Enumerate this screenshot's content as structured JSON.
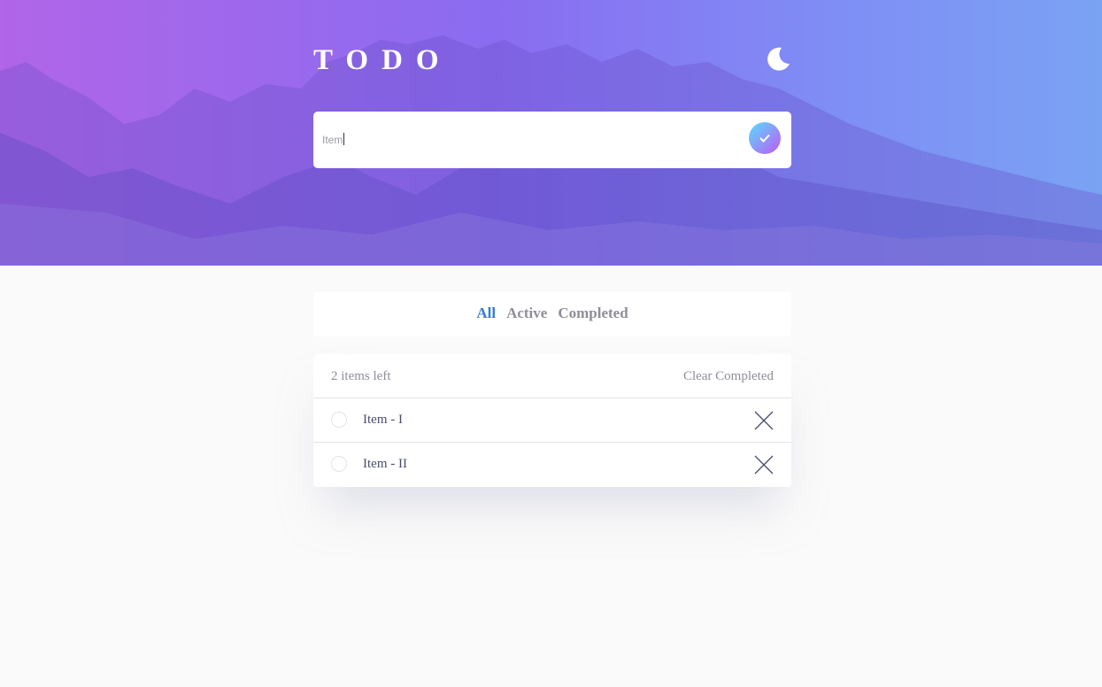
{
  "app": {
    "title": "TODO"
  },
  "header": {
    "theme_toggle_icon": "moon-icon"
  },
  "new_todo": {
    "value": "Item",
    "submit_icon": "check-icon"
  },
  "filters": {
    "tabs": [
      {
        "label": "All",
        "active": true
      },
      {
        "label": "Active",
        "active": false
      },
      {
        "label": "Completed",
        "active": false
      }
    ]
  },
  "list": {
    "items_left": "2 items left",
    "clear_completed": "Clear Completed",
    "items": [
      {
        "text": "Item - I",
        "completed": false,
        "delete_icon": "close-icon"
      },
      {
        "text": "Item - II",
        "completed": false,
        "delete_icon": "close-icon"
      }
    ]
  },
  "colors": {
    "accent": "#3a7bd5",
    "check_gradient_start": "#57ddff",
    "check_gradient_end": "#c058f3",
    "hero_left": "#b165e8",
    "hero_right": "#7aa3f4",
    "background": "#fafafa"
  }
}
